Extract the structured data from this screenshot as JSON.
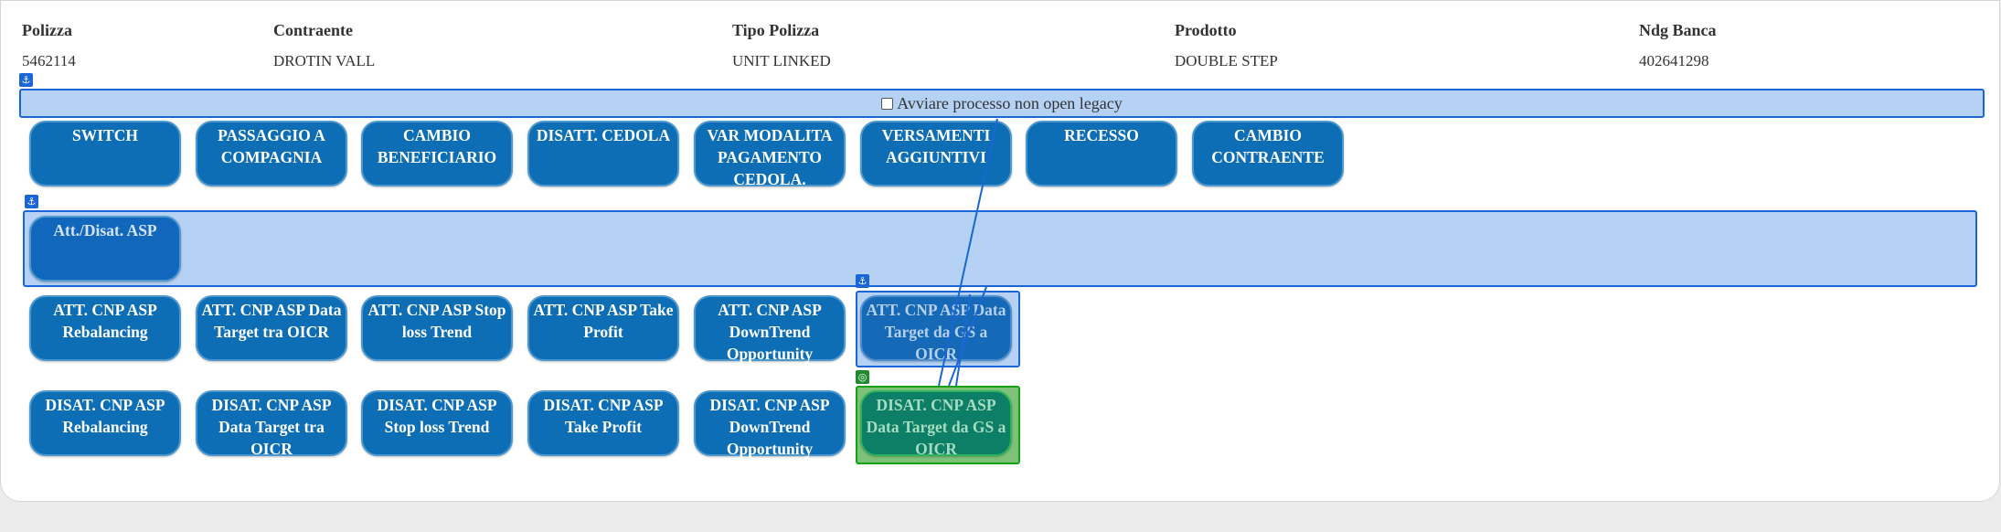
{
  "header": {
    "columns": [
      {
        "label": "Polizza",
        "value": "5462114"
      },
      {
        "label": "Contraente",
        "value": "DROTIN VALL"
      },
      {
        "label": "Tipo Polizza",
        "value": "UNIT LINKED"
      },
      {
        "label": "Prodotto",
        "value": "DOUBLE STEP"
      },
      {
        "label": "Ndg Banca",
        "value": "402641298"
      }
    ]
  },
  "legacy": {
    "label": "Avviare processo non open legacy",
    "checked": false
  },
  "icons": {
    "anchor": "⚓",
    "target": "◎"
  },
  "row1": [
    {
      "label": "SWITCH"
    },
    {
      "label": "PASSAGGIO A COMPAGNIA"
    },
    {
      "label": "CAMBIO BENEFICIARIO"
    },
    {
      "label": "DISATT. CEDOLA"
    },
    {
      "label": "VAR MODALITA PAGAMENTO CEDOLA."
    },
    {
      "label": "VERSAMENTI AGGIUNTIVI"
    },
    {
      "label": "RECESSO"
    },
    {
      "label": "CAMBIO CONTRAENTE"
    }
  ],
  "zone": {
    "button_label": "Att./Disat. ASP"
  },
  "row_att": [
    {
      "label": "ATT. CNP ASP Rebalancing"
    },
    {
      "label": "ATT. CNP ASP Data Target tra OICR"
    },
    {
      "label": "ATT. CNP ASP Stop loss Trend"
    },
    {
      "label": "ATT. CNP ASP Take Profit"
    },
    {
      "label": "ATT. CNP ASP DownTrend Opportunity"
    },
    {
      "label": "ATT. CNP ASP Data Target da GS a OICR"
    }
  ],
  "row_disat": [
    {
      "label": "DISAT. CNP ASP Rebalancing"
    },
    {
      "label": "DISAT. CNP ASP Data Target tra OICR"
    },
    {
      "label": "DISAT. CNP ASP Stop loss Trend"
    },
    {
      "label": "DISAT. CNP ASP Take Profit"
    },
    {
      "label": "DISAT. CNP ASP DownTrend Opportunity"
    },
    {
      "label": "DISAT. CNP ASP Data Target da GS a OICR"
    }
  ],
  "colors": {
    "primary_button": "#0d6eb6",
    "highlight": "#1a66d6",
    "drop_target": "#14a214"
  }
}
